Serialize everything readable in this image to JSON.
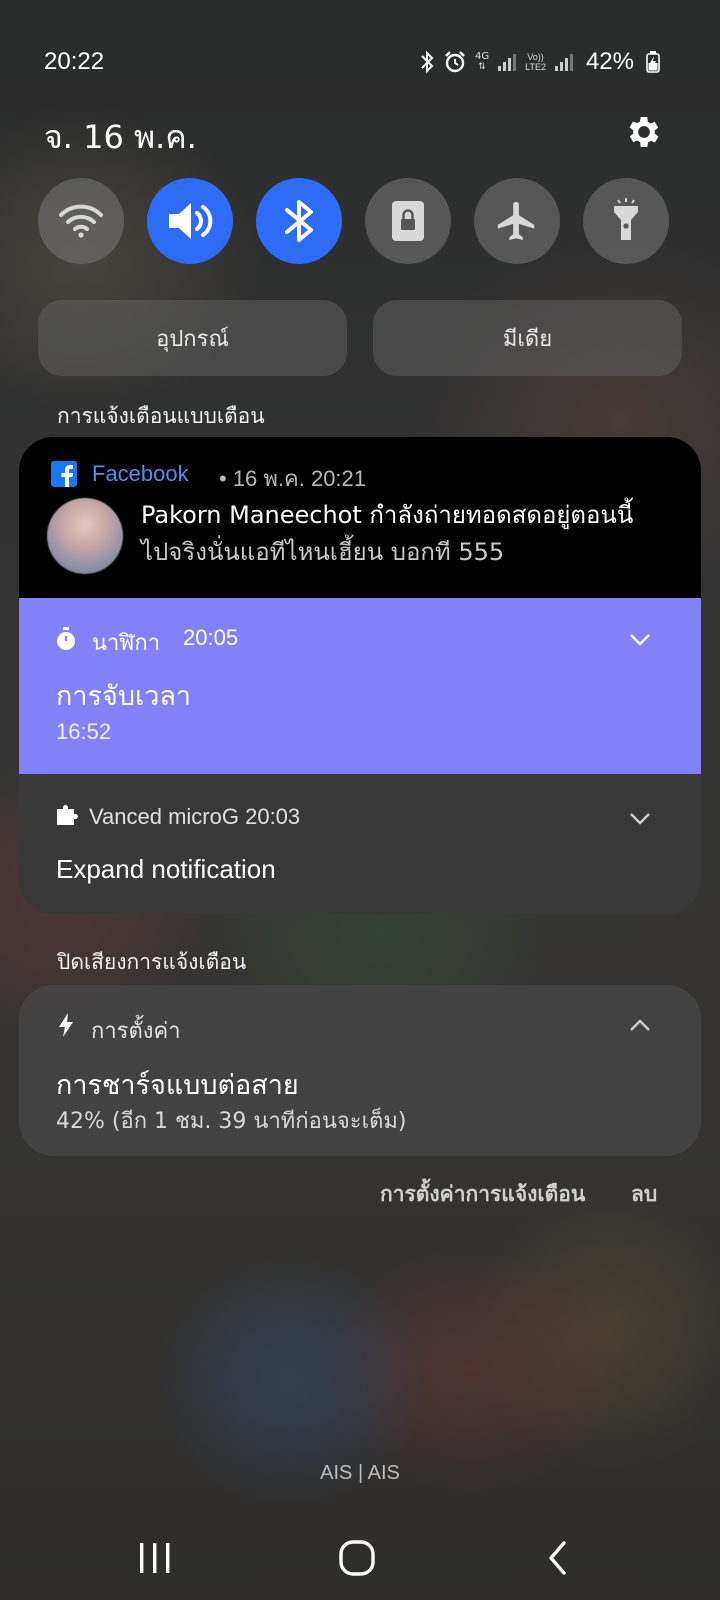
{
  "status_bar": {
    "time": "20:22",
    "network_type": "4G",
    "sim2_label_top": "Vo))",
    "sim2_label_bottom": "LTE2",
    "battery": "42%"
  },
  "header": {
    "date": "จ. 16 พ.ค."
  },
  "quick_toggles": [
    {
      "name": "wifi",
      "icon": "wifi-icon",
      "on": false
    },
    {
      "name": "sound",
      "icon": "volume-icon",
      "on": true
    },
    {
      "name": "bluetooth",
      "icon": "bluetooth-icon",
      "on": true
    },
    {
      "name": "rotation-lock",
      "icon": "portrait-lock-icon",
      "on": false
    },
    {
      "name": "airplane",
      "icon": "airplane-icon",
      "on": false
    },
    {
      "name": "flashlight",
      "icon": "flashlight-icon",
      "on": false
    }
  ],
  "pills": {
    "devices": "อุปกรณ์",
    "media": "มีเดีย"
  },
  "alerting_section_label": "การแจ้งเตือนแบบเตือน",
  "notifications": {
    "facebook": {
      "app": "Facebook",
      "meta": "• 16 พ.ค. 20:21",
      "title": "Pakorn Maneechot กำลังถ่ายทอดสดอยู่ตอนนี้",
      "text": "ไปจริงนั่นแอทีไหนเฮี้ยน บอกที 555"
    },
    "timer": {
      "app": "นาฬิกา",
      "time": "20:05",
      "title": "การจับเวลา",
      "value": "16:52"
    },
    "vanced": {
      "app": "Vanced microG  20:03",
      "title": "Expand notification"
    }
  },
  "silent_section_label": "ปิดเสียงการแจ้งเตือน",
  "silent_notification": {
    "app": "การตั้งค่า",
    "title": "การชาร์จแบบต่อสาย",
    "text": "42% (อีก 1 ชม. 39 นาทีก่อนจะเต็ม)"
  },
  "actions": {
    "notification_settings": "การตั้งค่าการแจ้งเตือน",
    "clear": "ลบ"
  },
  "carrier": "AIS | AIS",
  "colors": {
    "toggle_on": "#2e6cf6",
    "timer_card": "#8281f8",
    "facebook_blue": "#1877f2"
  }
}
